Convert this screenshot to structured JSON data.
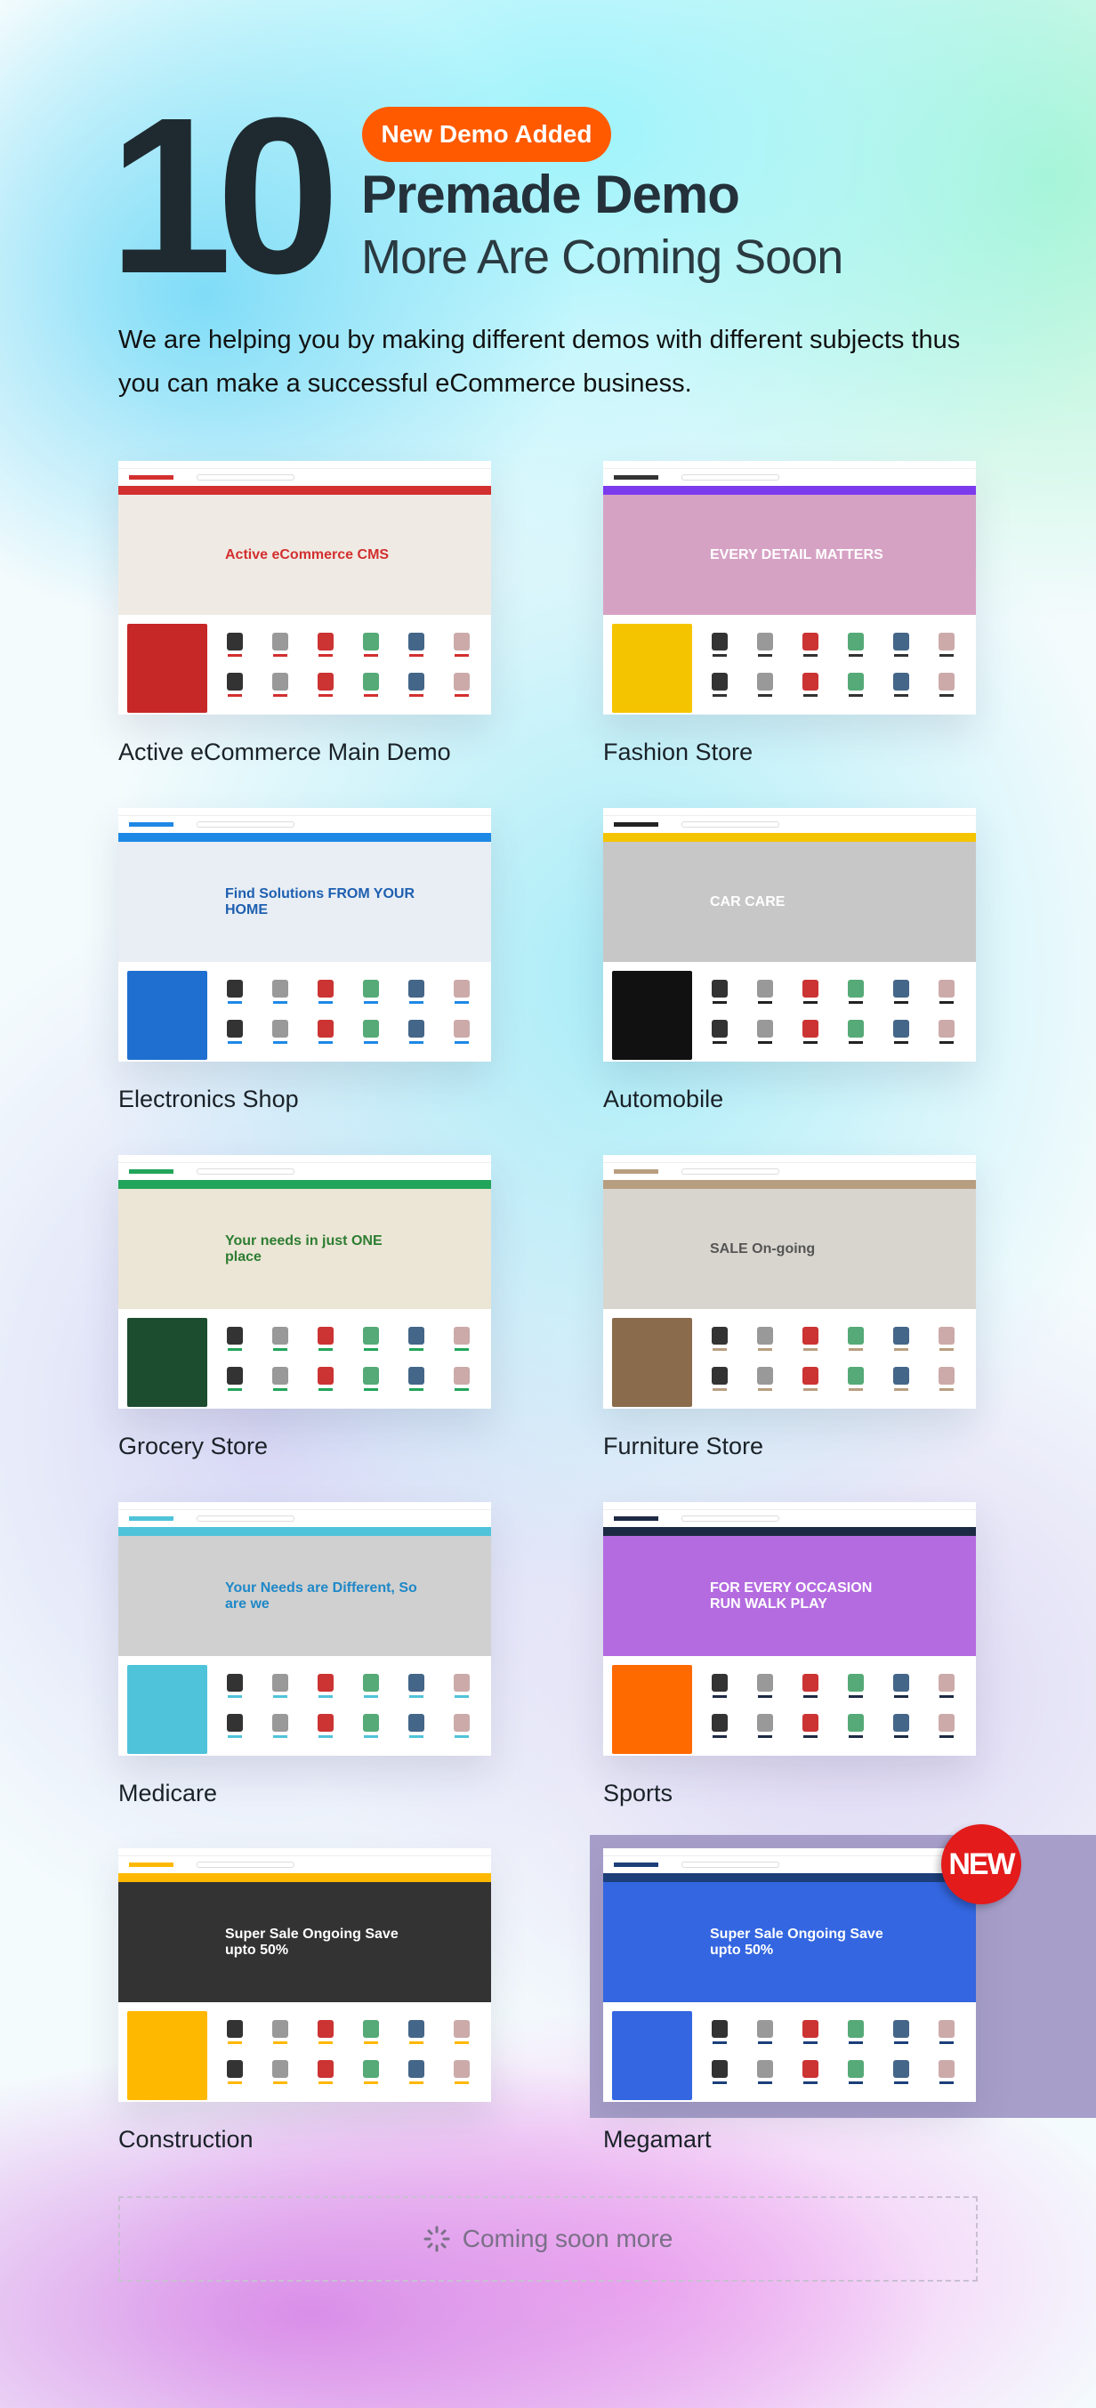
{
  "header": {
    "count": "10",
    "badge": "New Demo Added",
    "title": "Premade Demo",
    "subtitle": "More Are Coming Soon",
    "intro": "We are helping you by making different demos with different subjects thus you can make a successful eCommerce business."
  },
  "demos": [
    {
      "name": "Active eCommerce Main Demo",
      "nav": "#d32f2f",
      "banner": "#efebe4",
      "btext": "Active eCommerce CMS",
      "tcolor": "#d32f2f",
      "promo": "#c62828",
      "accent": "#d32f2f"
    },
    {
      "name": "Fashion Store",
      "nav": "#7c3aed",
      "banner": "#d6a2c4",
      "btext": "EVERY DETAIL MATTERS",
      "tcolor": "#ffffff",
      "promo": "#f5c400",
      "accent": "#333333"
    },
    {
      "name": "Electronics Shop",
      "nav": "#1e88e5",
      "banner": "#e8eef4",
      "btext": "Find Solutions FROM YOUR HOME",
      "tcolor": "#1e5fb0",
      "promo": "#1e6fd0",
      "accent": "#1e88e5"
    },
    {
      "name": "Automobile",
      "nav": "#f5c400",
      "banner": "#c7c7c7",
      "btext": "CAR CARE",
      "tcolor": "#ffffff",
      "promo": "#111111",
      "accent": "#222222"
    },
    {
      "name": "Grocery Store",
      "nav": "#22a55a",
      "banner": "#ece6d6",
      "btext": "Your needs in just ONE place",
      "tcolor": "#2e7d32",
      "promo": "#1b4d2e",
      "accent": "#22a55a"
    },
    {
      "name": "Furniture Store",
      "nav": "#b89e80",
      "banner": "#d8d5cf",
      "btext": "SALE On-going",
      "tcolor": "#555555",
      "promo": "#8a6b4c",
      "accent": "#b89e80"
    },
    {
      "name": "Medicare",
      "nav": "#4fc3d9",
      "banner": "#d0d0d0",
      "btext": "Your Needs are Different, So are we",
      "tcolor": "#1e88c8",
      "promo": "#4fc3d9",
      "accent": "#4fc3d9"
    },
    {
      "name": "Sports",
      "nav": "#1d2a44",
      "banner": "#b46be0",
      "btext": "FOR EVERY OCCASION RUN WALK PLAY",
      "tcolor": "#ffffff",
      "promo": "#ff6a00",
      "accent": "#1d2a44"
    },
    {
      "name": "Construction",
      "nav": "#ffb800",
      "banner": "#333333",
      "btext": "Super Sale Ongoing Save upto 50%",
      "tcolor": "#ffffff",
      "promo": "#ffb800",
      "accent": "#ffb800"
    },
    {
      "name": "Megamart",
      "nav": "#1c3f7a",
      "banner": "#3366e0",
      "btext": "Super Sale Ongoing Save upto 50%",
      "tcolor": "#ffffff",
      "promo": "#3366e0",
      "accent": "#1c3f7a"
    }
  ],
  "new_tag": "NEW",
  "coming_soon": {
    "icon": "spinner-icon",
    "label": "Coming soon more"
  }
}
